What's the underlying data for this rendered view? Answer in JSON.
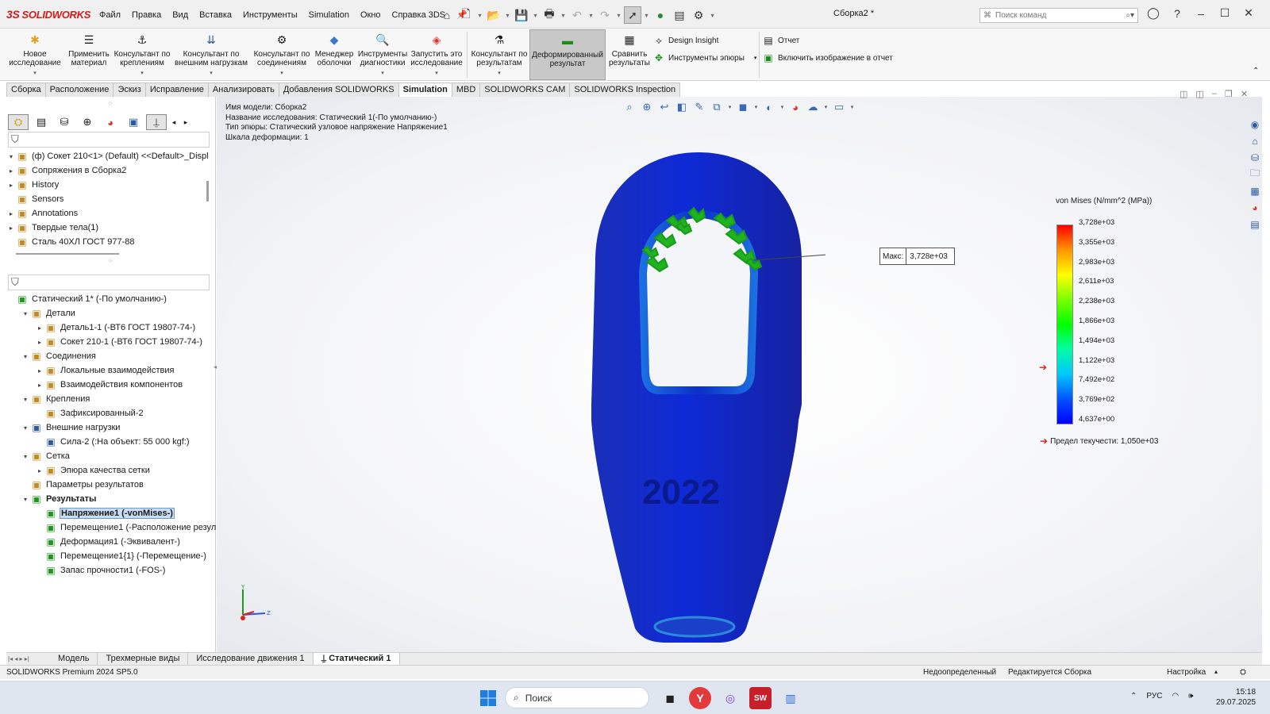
{
  "app": {
    "logo_text": "SOLIDWORKS",
    "document_title": "Сборка2 *",
    "command_search_placeholder": "Поиск команд"
  },
  "menu": [
    "Файл",
    "Правка",
    "Вид",
    "Вставка",
    "Инструменты",
    "Simulation",
    "Окно",
    "Справка 3DS"
  ],
  "ribbon": {
    "buttons": [
      {
        "name": "new-study-button",
        "line1": "Новое",
        "line2": "исследование",
        "icon": "new-study-icon"
      },
      {
        "name": "apply-material-button",
        "line1": "Применить",
        "line2": "материал",
        "icon": "material-icon"
      },
      {
        "name": "fixtures-advisor-button",
        "line1": "Консультант по",
        "line2": "креплениям",
        "icon": "fixture-icon"
      },
      {
        "name": "external-loads-advisor-button",
        "line1": "Консультант по",
        "line2": "внешним нагрузкам",
        "icon": "load-icon"
      },
      {
        "name": "connections-advisor-button",
        "line1": "Консультант по",
        "line2": "соединениям",
        "icon": "connection-icon"
      },
      {
        "name": "shell-manager-button",
        "line1": "Менеджер",
        "line2": "оболочки",
        "icon": "shell-icon"
      },
      {
        "name": "diagnostic-tools-button",
        "line1": "Инструменты",
        "line2": "диагностики",
        "icon": "diagnostic-icon"
      },
      {
        "name": "run-study-button",
        "line1": "Запустить это",
        "line2": "исследование",
        "icon": "run-icon"
      },
      {
        "name": "results-advisor-button",
        "line1": "Консультант по",
        "line2": "результатам",
        "icon": "results-advisor-icon"
      },
      {
        "name": "deformed-result-button",
        "line1": "Деформированный",
        "line2": "результат",
        "icon": "deformed-icon"
      },
      {
        "name": "compare-results-button",
        "line1": "Сравнить",
        "line2": "результаты",
        "icon": "compare-icon"
      }
    ],
    "small": {
      "design_insight": "Design Insight",
      "plot_tools": "Инструменты эпюры",
      "report": "Отчет",
      "include_image": "Включить изображение в отчет"
    }
  },
  "tabs": [
    "Сборка",
    "Расположение",
    "Эскиз",
    "Исправление",
    "Анализировать",
    "Добавления SOLIDWORKS",
    "Simulation",
    "MBD",
    "SOLIDWORKS CAM",
    "SOLIDWORKS Inspection"
  ],
  "active_tab": "Simulation",
  "feature_tree": [
    {
      "label": "(ф) Сокет 210<1> (Default) <<Default>_Displ",
      "icon": "part-icon",
      "exp": "▾"
    },
    {
      "label": "Сопряжения в Сборка2",
      "icon": "mates-icon",
      "exp": "▸"
    },
    {
      "label": "History",
      "icon": "history-icon",
      "exp": "▸"
    },
    {
      "label": "Sensors",
      "icon": "sensor-icon",
      "exp": ""
    },
    {
      "label": "Annotations",
      "icon": "annotation-icon",
      "exp": "▸"
    },
    {
      "label": "Твердые тела(1)",
      "icon": "solid-bodies-icon",
      "exp": "▸"
    },
    {
      "label": "Сталь 40ХЛ ГОСТ 977-88",
      "icon": "material-icon",
      "exp": ""
    }
  ],
  "sim_tree": [
    {
      "label": "Статический 1* (-По умолчанию-)",
      "indent": 0,
      "exp": "",
      "icon": "study-icon"
    },
    {
      "label": "Детали",
      "indent": 1,
      "exp": "▾",
      "icon": "parts-icon"
    },
    {
      "label": "Деталь1-1 (-ВТ6 ГОСТ 19807-74-)",
      "indent": 2,
      "exp": "▸",
      "icon": "part-check-icon"
    },
    {
      "label": "Сокет 210-1 (-ВТ6 ГОСТ 19807-74-)",
      "indent": 2,
      "exp": "▸",
      "icon": "part-check-icon"
    },
    {
      "label": "Соединения",
      "indent": 1,
      "exp": "▾",
      "icon": "connections-icon"
    },
    {
      "label": "Локальные взаимодействия",
      "indent": 2,
      "exp": "▸",
      "icon": "local-interaction-icon"
    },
    {
      "label": "Взаимодействия компонентов",
      "indent": 2,
      "exp": "▸",
      "icon": "component-interaction-icon"
    },
    {
      "label": "Крепления",
      "indent": 1,
      "exp": "▾",
      "icon": "fixtures-icon"
    },
    {
      "label": "Зафиксированный-2",
      "indent": 2,
      "exp": "",
      "icon": "fixed-icon"
    },
    {
      "label": "Внешние нагрузки",
      "indent": 1,
      "exp": "▾",
      "icon": "external-loads-icon"
    },
    {
      "label": "Сила-2 (:На объект: 55 000 kgf:)",
      "indent": 2,
      "exp": "",
      "icon": "force-icon"
    },
    {
      "label": "Сетка",
      "indent": 1,
      "exp": "▾",
      "icon": "mesh-icon"
    },
    {
      "label": "Эпюра качества сетки",
      "indent": 2,
      "exp": "▸",
      "icon": "mesh-quality-icon"
    },
    {
      "label": "Параметры результатов",
      "indent": 1,
      "exp": "",
      "icon": "result-options-icon"
    },
    {
      "label": "Результаты",
      "indent": 1,
      "exp": "▾",
      "icon": "results-icon",
      "bold": true
    },
    {
      "label": "Напряжение1 (-vonMises-)",
      "indent": 2,
      "exp": "",
      "icon": "stress-plot-icon",
      "selected": true
    },
    {
      "label": "Перемещение1 (-Расположение результата",
      "indent": 2,
      "exp": "",
      "icon": "displacement-plot-icon"
    },
    {
      "label": "Деформация1 (-Эквивалент-)",
      "indent": 2,
      "exp": "",
      "icon": "strain-plot-icon"
    },
    {
      "label": "Перемещение1{1} (-Перемещение-)",
      "indent": 2,
      "exp": "",
      "icon": "displacement-plot-icon"
    },
    {
      "label": "Запас прочности1 (-FOS-)",
      "indent": 2,
      "exp": "",
      "icon": "fos-plot-icon"
    }
  ],
  "model_info": {
    "model_name": "Имя модели: Сборка2",
    "study_name": "Название исследования: Статический 1(-По умолчанию-)",
    "plot_type": "Тип эпюры: Статический узловое напряжение Напряжение1",
    "deformation_scale": "Шкала деформации: 1"
  },
  "legend": {
    "title": "von Mises (N/mm^2 (MPa))",
    "ticks": [
      "3,728e+03",
      "3,355e+03",
      "2,983e+03",
      "2,611e+03",
      "2,238e+03",
      "1,866e+03",
      "1,494e+03",
      "1,122e+03",
      "7,492e+02",
      "3,769e+02",
      "4,637e+00"
    ],
    "yield_label": "Предел текучести: 1,050e+03",
    "yield_value": 1050,
    "max_value": 3728,
    "colors": {
      "max": "#ff0000",
      "min": "#0000ff"
    }
  },
  "probe": {
    "label": "Макс:",
    "value": "3,728e+03"
  },
  "model_text": "2022",
  "bottom_tabs": [
    "Модель",
    "Трехмерные виды",
    "Исследование движения 1",
    "Статический 1"
  ],
  "active_bottom_tab": "Статический 1",
  "status": {
    "product": "SOLIDWORKS Premium 2024 SP5.0",
    "state": "Недоопределенный",
    "editing": "Редактируется Сборка",
    "custom": "Настройка"
  },
  "taskbar": {
    "search": "Поиск",
    "lang": "РУС",
    "time": "15:18",
    "date": "29.07.2025"
  }
}
